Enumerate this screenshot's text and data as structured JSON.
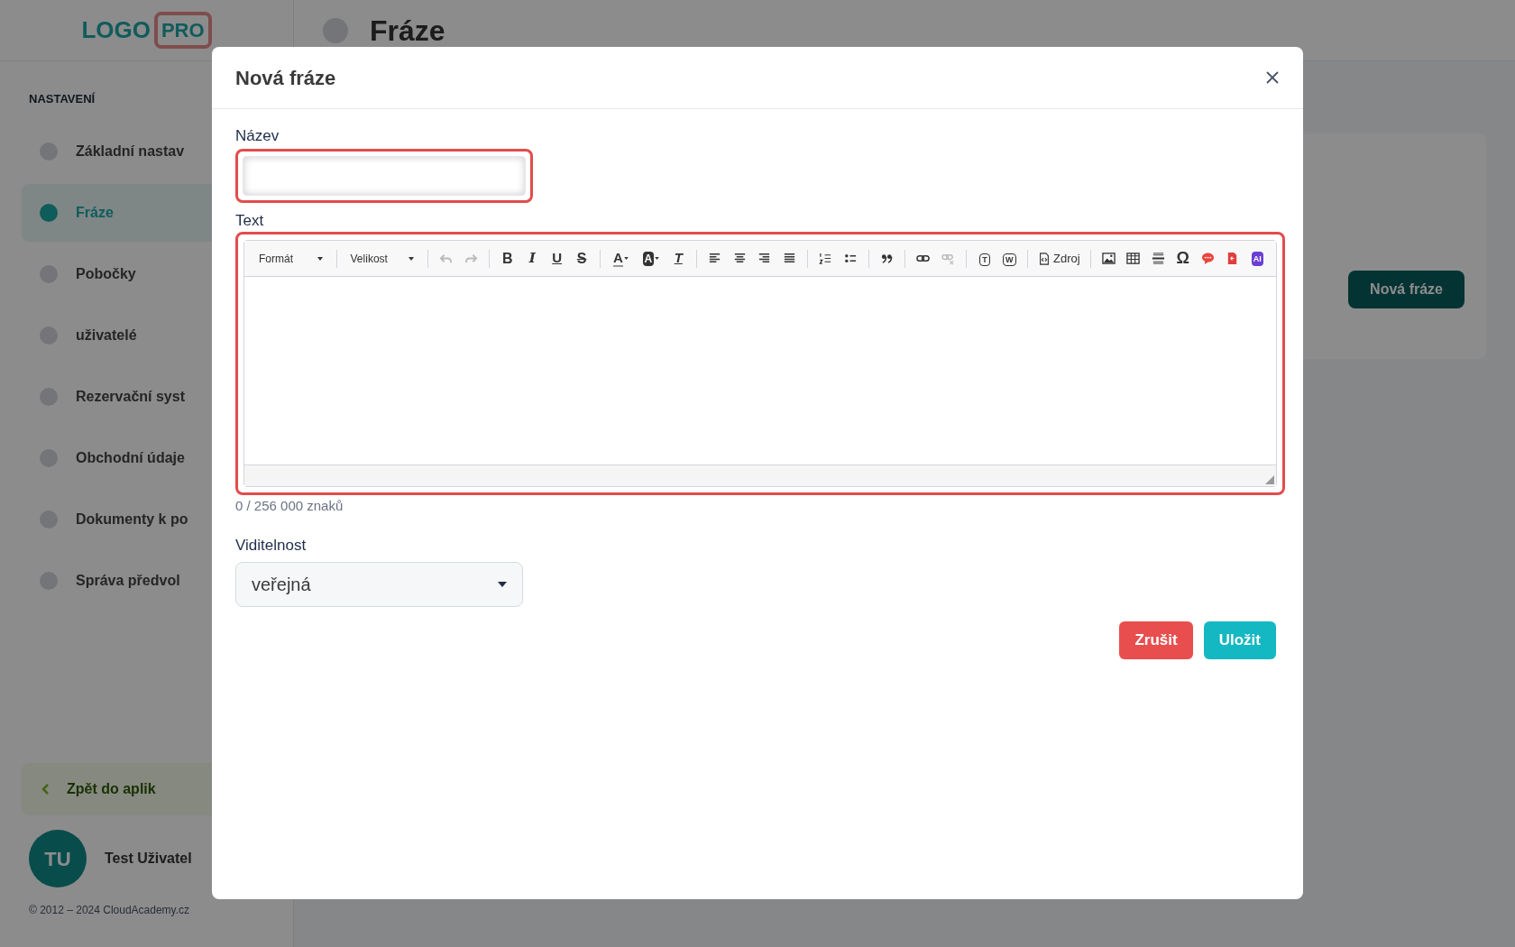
{
  "background": {
    "logo": {
      "word": "LOGO",
      "badge": "PRO"
    },
    "page_title": "Fráze",
    "sidebar": {
      "section": "NASTAVENÍ",
      "items": [
        {
          "label": "Základní nastav",
          "selected": false
        },
        {
          "label": "Fráze",
          "selected": true
        },
        {
          "label": "Pobočky",
          "selected": false
        },
        {
          "label": "uživatelé",
          "selected": false
        },
        {
          "label": "Rezervační syst",
          "selected": false
        },
        {
          "label": "Obchodní údaje",
          "selected": false
        },
        {
          "label": "Dokumenty k po",
          "selected": false
        },
        {
          "label": "Správa předvol",
          "selected": false
        }
      ],
      "back_button": "Zpět do aplik",
      "user": {
        "initials": "TU",
        "name": "Test Uživatel"
      },
      "footer": "© 2012 – 2024 CloudAcademy.cz"
    },
    "action_button": "Nová fráze"
  },
  "modal": {
    "title": "Nová fráze",
    "name_field": {
      "label": "Název",
      "invalid": true
    },
    "text_field": {
      "label": "Text",
      "invalid": true,
      "counter": "0 / 256 000 znaků",
      "toolbar": [
        {
          "kind": "dropdown",
          "label": "Formát"
        },
        {
          "kind": "separator"
        },
        {
          "kind": "dropdown",
          "label": "Velikost"
        },
        {
          "kind": "separator"
        },
        {
          "kind": "undo",
          "disabled": true
        },
        {
          "kind": "redo",
          "disabled": true
        },
        {
          "kind": "separator"
        },
        {
          "kind": "bold",
          "glyph": "B"
        },
        {
          "kind": "italic",
          "glyph": "I"
        },
        {
          "kind": "underline",
          "glyph": "U"
        },
        {
          "kind": "strike",
          "glyph": "S"
        },
        {
          "kind": "separator"
        },
        {
          "kind": "text-color",
          "glyph": "A"
        },
        {
          "kind": "bg-color",
          "glyph": "A"
        },
        {
          "kind": "clear-format",
          "glyph": "T"
        },
        {
          "kind": "separator"
        },
        {
          "kind": "align-left"
        },
        {
          "kind": "align-center"
        },
        {
          "kind": "align-right"
        },
        {
          "kind": "justify"
        },
        {
          "kind": "separator"
        },
        {
          "kind": "numbered-list"
        },
        {
          "kind": "bulleted-list"
        },
        {
          "kind": "separator"
        },
        {
          "kind": "quote"
        },
        {
          "kind": "separator"
        },
        {
          "kind": "link",
          "disabled": false
        },
        {
          "kind": "unlink",
          "disabled": true
        },
        {
          "kind": "separator"
        },
        {
          "kind": "paste-text",
          "glyph": "T"
        },
        {
          "kind": "paste-word",
          "glyph": "W"
        },
        {
          "kind": "separator"
        },
        {
          "kind": "source",
          "label": "Zdroj"
        },
        {
          "kind": "separator"
        },
        {
          "kind": "image"
        },
        {
          "kind": "table"
        },
        {
          "kind": "rule"
        },
        {
          "kind": "special-char",
          "glyph": "Ω"
        },
        {
          "kind": "comment"
        },
        {
          "kind": "pdf"
        },
        {
          "kind": "ai",
          "glyph": "AI"
        }
      ]
    },
    "visibility": {
      "label": "Viditelnost",
      "value": "veřejná"
    },
    "buttons": [
      {
        "kind": "cancel",
        "label": "Zrušit"
      },
      {
        "kind": "save",
        "label": "Uložit"
      }
    ]
  }
}
